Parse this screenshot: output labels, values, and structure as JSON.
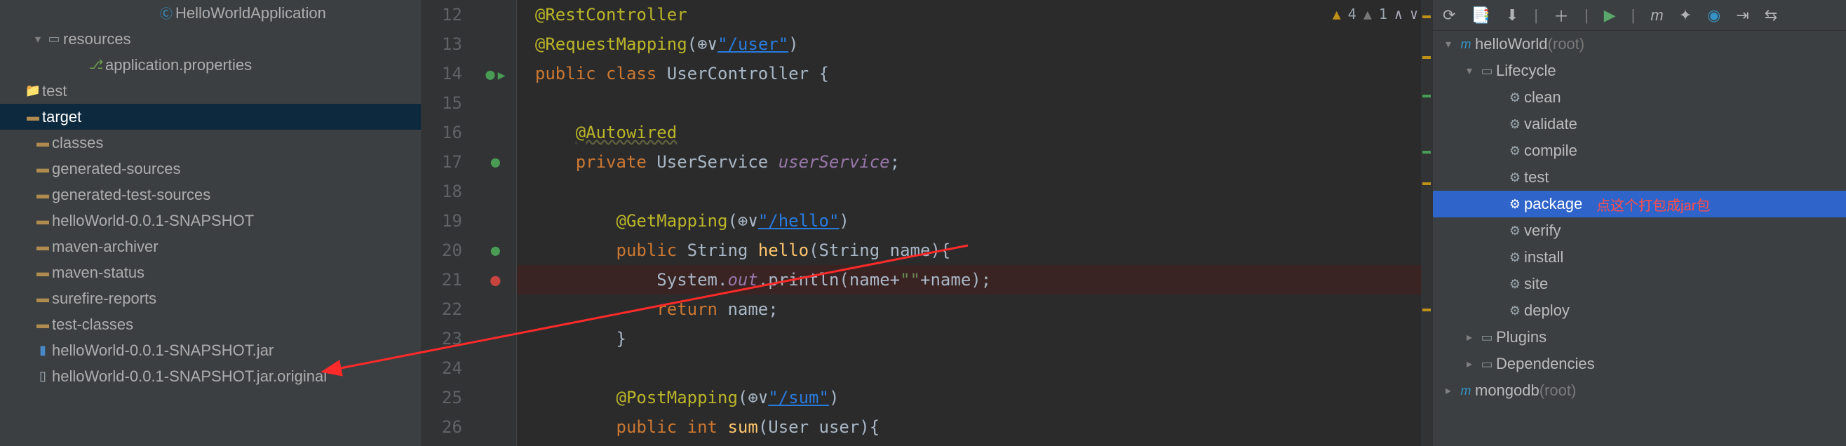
{
  "project_tree": {
    "items": [
      {
        "indent": 190,
        "chev": "",
        "icon": "class",
        "label": "HelloWorldApplication"
      },
      {
        "indent": 30,
        "chev": "▾",
        "icon": "folder-res",
        "label": "resources"
      },
      {
        "indent": 90,
        "chev": "",
        "icon": "leaf",
        "label": "application.properties"
      },
      {
        "indent": 0,
        "chev": "",
        "icon": "folder",
        "label": "test"
      },
      {
        "indent": 0,
        "chev": "",
        "icon": "folder-src",
        "label": "target",
        "selected": true
      },
      {
        "indent": 14,
        "chev": "",
        "icon": "folder-src",
        "label": "classes"
      },
      {
        "indent": 14,
        "chev": "",
        "icon": "folder-src",
        "label": "generated-sources"
      },
      {
        "indent": 14,
        "chev": "",
        "icon": "folder-src",
        "label": "generated-test-sources"
      },
      {
        "indent": 14,
        "chev": "",
        "icon": "folder-src",
        "label": "helloWorld-0.0.1-SNAPSHOT"
      },
      {
        "indent": 14,
        "chev": "",
        "icon": "folder-src",
        "label": "maven-archiver"
      },
      {
        "indent": 14,
        "chev": "",
        "icon": "folder-src",
        "label": "maven-status"
      },
      {
        "indent": 14,
        "chev": "",
        "icon": "folder-src",
        "label": "surefire-reports"
      },
      {
        "indent": 14,
        "chev": "",
        "icon": "folder-src",
        "label": "test-classes"
      },
      {
        "indent": 14,
        "chev": "",
        "icon": "jar",
        "label": "helloWorld-0.0.1-SNAPSHOT.jar"
      },
      {
        "indent": 14,
        "chev": "",
        "icon": "file",
        "label": "helloWorld-0.0.1-SNAPSHOT.jar.original"
      }
    ]
  },
  "editor": {
    "inspections": {
      "warn_count": "4",
      "weak_count": "1"
    },
    "lines": [
      {
        "n": 12,
        "mark": "",
        "html": "<span class='tok-ann'>@RestController</span>"
      },
      {
        "n": 13,
        "mark": "",
        "html": "<span class='tok-ann'>@RequestMapping</span>(<span class='tok-sym'>⊕∨</span><span class='tok-strlink'>\"/user\"</span>)"
      },
      {
        "n": 14,
        "mark": "run",
        "html": "<span class='tok-kw'>public class </span><span class='tok-sym'>UserController {</span>"
      },
      {
        "n": 15,
        "mark": "",
        "html": ""
      },
      {
        "n": 16,
        "mark": "",
        "html": "    <span class='tok-auto'>@Autowired</span>"
      },
      {
        "n": 17,
        "mark": "green",
        "html": "    <span class='tok-kw'>private </span><span class='tok-sym'>UserService </span><span class='tok-field'>userService</span><span class='tok-sym'>;</span>"
      },
      {
        "n": 18,
        "mark": "",
        "html": ""
      },
      {
        "n": 19,
        "mark": "",
        "html": "        <span class='tok-ann'>@GetMapping</span>(<span class='tok-sym'>⊕∨</span><span class='tok-strlink'>\"/hello\"</span>)"
      },
      {
        "n": 20,
        "mark": "green",
        "html": "        <span class='tok-kw'>public </span><span class='tok-sym'>String </span><span class='tok-method'>hello</span><span class='tok-sym'>(String name){</span>"
      },
      {
        "n": 21,
        "mark": "bp",
        "hl": true,
        "html": "            <span class='tok-sym'>System.</span><span class='tok-static'>out</span><span class='tok-sym'>.println(name+</span><span class='tok-str'>\"\"</span><span class='tok-sym'>+name);</span>"
      },
      {
        "n": 22,
        "mark": "",
        "html": "            <span class='tok-kw'>return </span><span class='tok-sym'>name;</span>"
      },
      {
        "n": 23,
        "mark": "",
        "html": "        <span class='tok-sym'>}</span>"
      },
      {
        "n": 24,
        "mark": "",
        "html": ""
      },
      {
        "n": 25,
        "mark": "",
        "html": "        <span class='tok-ann'>@PostMapping</span>(<span class='tok-sym'>⊕∨</span><span class='tok-strlink'>\"/sum\"</span>)"
      },
      {
        "n": 26,
        "mark": "",
        "html": "        <span class='tok-kw'>public int </span><span class='tok-method'>sum</span><span class='tok-sym'>(User user){</span>"
      }
    ]
  },
  "maven": {
    "root": {
      "name": "helloWorld",
      "hint": "(root)"
    },
    "lifecycle_label": "Lifecycle",
    "goals": [
      "clean",
      "validate",
      "compile",
      "test",
      "package",
      "verify",
      "install",
      "site",
      "deploy"
    ],
    "selected_goal": "package",
    "annotation_text": "点这个打包成jar包",
    "plugins_label": "Plugins",
    "deps_label": "Dependencies",
    "second_root": {
      "name": "mongodb",
      "hint": "(root)"
    }
  }
}
